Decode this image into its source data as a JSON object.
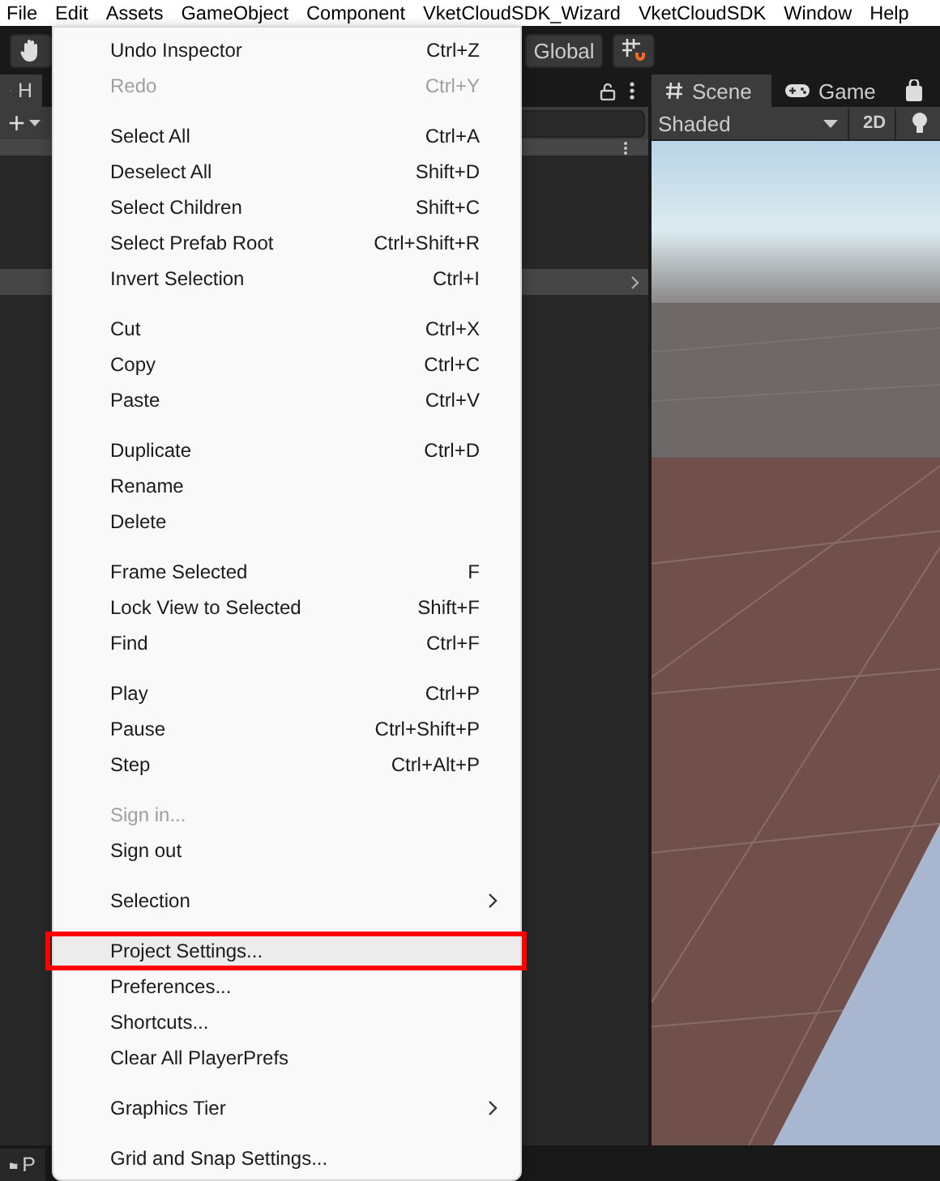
{
  "menubar": [
    {
      "label": "File"
    },
    {
      "label": "Edit"
    },
    {
      "label": "Assets"
    },
    {
      "label": "GameObject"
    },
    {
      "label": "Component"
    },
    {
      "label": "VketCloudSDK_Wizard"
    },
    {
      "label": "VketCloudSDK"
    },
    {
      "label": "Window"
    },
    {
      "label": "Help"
    }
  ],
  "toolbar": {
    "global_button": "Global"
  },
  "hierarchy": {
    "tab_label": "H",
    "add_button": "+"
  },
  "scene": {
    "tabs": [
      {
        "label": "Scene",
        "selected": true
      },
      {
        "label": "Game",
        "selected": false
      }
    ],
    "shading_dropdown": "Shaded",
    "mode_button": "2D"
  },
  "project_tab": "P",
  "edit_menu": {
    "groups": [
      [
        {
          "label": "Undo Inspector",
          "shortcut": "Ctrl+Z",
          "disabled": false,
          "selected": false,
          "submenu": false
        },
        {
          "label": "Redo",
          "shortcut": "Ctrl+Y",
          "disabled": true,
          "selected": false,
          "submenu": false
        }
      ],
      [
        {
          "label": "Select All",
          "shortcut": "Ctrl+A",
          "disabled": false,
          "selected": false,
          "submenu": false
        },
        {
          "label": "Deselect All",
          "shortcut": "Shift+D",
          "disabled": false,
          "selected": false,
          "submenu": false
        },
        {
          "label": "Select Children",
          "shortcut": "Shift+C",
          "disabled": false,
          "selected": false,
          "submenu": false
        },
        {
          "label": "Select Prefab Root",
          "shortcut": "Ctrl+Shift+R",
          "disabled": false,
          "selected": false,
          "submenu": false
        },
        {
          "label": "Invert Selection",
          "shortcut": "Ctrl+I",
          "disabled": false,
          "selected": false,
          "submenu": false
        }
      ],
      [
        {
          "label": "Cut",
          "shortcut": "Ctrl+X",
          "disabled": false,
          "selected": false,
          "submenu": false
        },
        {
          "label": "Copy",
          "shortcut": "Ctrl+C",
          "disabled": false,
          "selected": false,
          "submenu": false
        },
        {
          "label": "Paste",
          "shortcut": "Ctrl+V",
          "disabled": false,
          "selected": false,
          "submenu": false
        }
      ],
      [
        {
          "label": "Duplicate",
          "shortcut": "Ctrl+D",
          "disabled": false,
          "selected": false,
          "submenu": false
        },
        {
          "label": "Rename",
          "disabled": false,
          "selected": false,
          "submenu": false
        },
        {
          "label": "Delete",
          "disabled": false,
          "selected": false,
          "submenu": false
        }
      ],
      [
        {
          "label": "Frame Selected",
          "shortcut": "F",
          "disabled": false,
          "selected": false,
          "submenu": false
        },
        {
          "label": "Lock View to Selected",
          "shortcut": "Shift+F",
          "disabled": false,
          "selected": false,
          "submenu": false
        },
        {
          "label": "Find",
          "shortcut": "Ctrl+F",
          "disabled": false,
          "selected": false,
          "submenu": false
        }
      ],
      [
        {
          "label": "Play",
          "shortcut": "Ctrl+P",
          "disabled": false,
          "selected": false,
          "submenu": false
        },
        {
          "label": "Pause",
          "shortcut": "Ctrl+Shift+P",
          "disabled": false,
          "selected": false,
          "submenu": false
        },
        {
          "label": "Step",
          "shortcut": "Ctrl+Alt+P",
          "disabled": false,
          "selected": false,
          "submenu": false
        }
      ],
      [
        {
          "label": "Sign in...",
          "disabled": true,
          "selected": false,
          "submenu": false
        },
        {
          "label": "Sign out",
          "disabled": false,
          "selected": false,
          "submenu": false
        }
      ],
      [
        {
          "label": "Selection",
          "disabled": false,
          "selected": false,
          "submenu": true
        }
      ],
      [
        {
          "label": "Project Settings...",
          "disabled": false,
          "selected": true,
          "submenu": false
        },
        {
          "label": "Preferences...",
          "disabled": false,
          "selected": false,
          "submenu": false
        },
        {
          "label": "Shortcuts...",
          "disabled": false,
          "selected": false,
          "submenu": false
        },
        {
          "label": "Clear All PlayerPrefs",
          "disabled": false,
          "selected": false,
          "submenu": false
        }
      ],
      [
        {
          "label": "Graphics Tier",
          "disabled": false,
          "selected": false,
          "submenu": true
        }
      ],
      [
        {
          "label": "Grid and Snap Settings...",
          "disabled": false,
          "selected": false,
          "submenu": false
        }
      ]
    ]
  }
}
